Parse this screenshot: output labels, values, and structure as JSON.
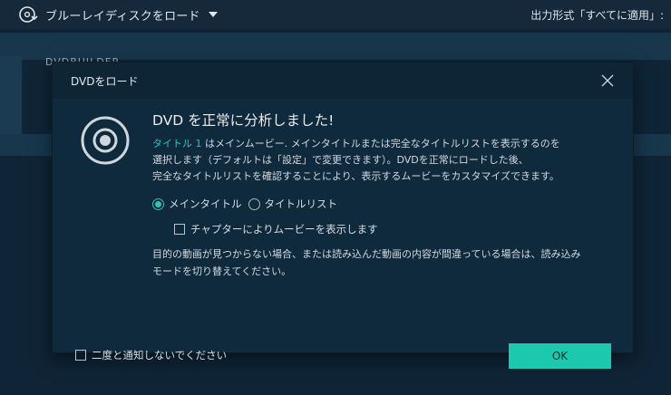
{
  "app": {
    "load_menu_label": "ブルーレイディスクをロード",
    "output_format": "出力形式「すべてに適用」:",
    "project_label": "DVDBUILDER",
    "icons": {
      "load": "disc-load-icon",
      "menu": "caret-down-icon"
    }
  },
  "dialog": {
    "title": "DVDをロード",
    "heading": "DVD を正常に分析しました!",
    "title_link": "タイトル 1",
    "desc_line1_rest": " はメインムービー. メインタイトルまたは完全なタイトルリストを表示するのを",
    "desc_line2": "選択します（デフォルトは「設定」で変更できます）。DVDを正常にロードした後、",
    "desc_line3": "完全なタイトルリストを確認することにより、表示するムービーをカスタマイズできます。",
    "options": {
      "main_title": "メインタイトル",
      "title_list": "タイトルリスト",
      "selected": "メインタイトル"
    },
    "chapter_checkbox_label": "チャプターによりムービーを表示します",
    "hint_line1": "目的の動画が見つからない場合、または読み込んだ動画の内容が間違っている場合は、読み込み",
    "hint_line2": "モードを切り替えてください。",
    "dont_notify_label": "二度と通知しないでください",
    "ok_label": "OK",
    "icons": {
      "close": "close-icon",
      "dvd": "dvd-disc-icon"
    }
  },
  "colors": {
    "accent": "#1cc9ad",
    "background": "#0f2436",
    "dialog": "#102a3d"
  }
}
